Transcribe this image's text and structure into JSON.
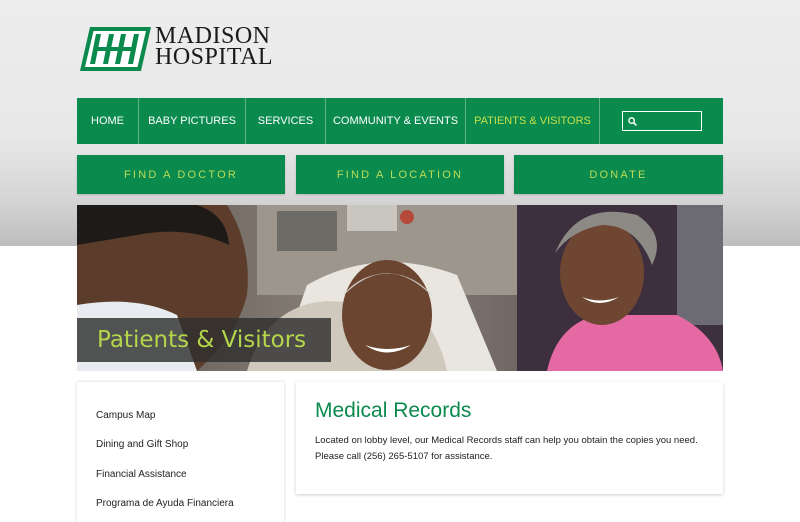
{
  "brand": {
    "line1": "MADISON",
    "line2": "HOSPITAL"
  },
  "nav": {
    "items": [
      "HOME",
      "BABY PICTURES",
      "SERVICES",
      "COMMUNITY & EVENTS",
      "PATIENTS & VISITORS"
    ],
    "active_item": "PATIENTS & VISITORS",
    "search_placeholder": ""
  },
  "quick_links": [
    "FIND A DOCTOR",
    "FIND A LOCATION",
    "DONATE"
  ],
  "hero": {
    "caption": "Patients & Visitors"
  },
  "sidebar": {
    "items": [
      "Campus Map",
      "Dining and Gift Shop",
      "Financial Assistance",
      "Programa de Ayuda Financiera"
    ]
  },
  "content": {
    "title": "Medical Records",
    "line1": "Located on lobby level, our Medical Records staff can help you obtain the copies you need.",
    "line2": "Please call (256) 265-5107 for assistance."
  },
  "colors": {
    "brand_green": "#0b8a4e",
    "accent_lime": "#c5e04a"
  },
  "icons": {
    "search": "search-icon"
  }
}
